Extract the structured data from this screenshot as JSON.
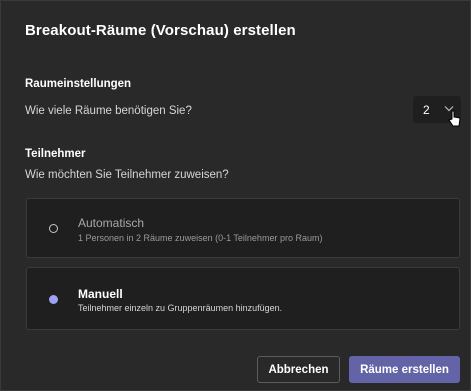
{
  "dialog": {
    "title": "Breakout-Räume (Vorschau) erstellen"
  },
  "room_settings": {
    "heading": "Raumeinstellungen",
    "question": "Wie viele Räume benötigen Sie?",
    "rooms_count": "2",
    "dropdown_icon": "chevron-down-icon"
  },
  "participants": {
    "heading": "Teilnehmer",
    "question": "Wie möchten Sie Teilnehmer zuweisen?",
    "options": [
      {
        "label": "Automatisch",
        "description": "1 Personen in 2 Räume zuweisen (0-1 Teilnehmer pro Raum)",
        "selected": false
      },
      {
        "label": "Manuell",
        "description": "Teilnehmer einzeln zu Gruppenräumen hinzufügen.",
        "selected": true
      }
    ]
  },
  "footer": {
    "cancel_label": "Abbrechen",
    "create_label": "Räume erstellen"
  },
  "colors": {
    "dialog_bg": "#292929",
    "card_bg": "#1f1f1f",
    "accent": "#6264a7",
    "radio_selected": "#9ea2f5",
    "muted_text": "#a8a8a8"
  }
}
